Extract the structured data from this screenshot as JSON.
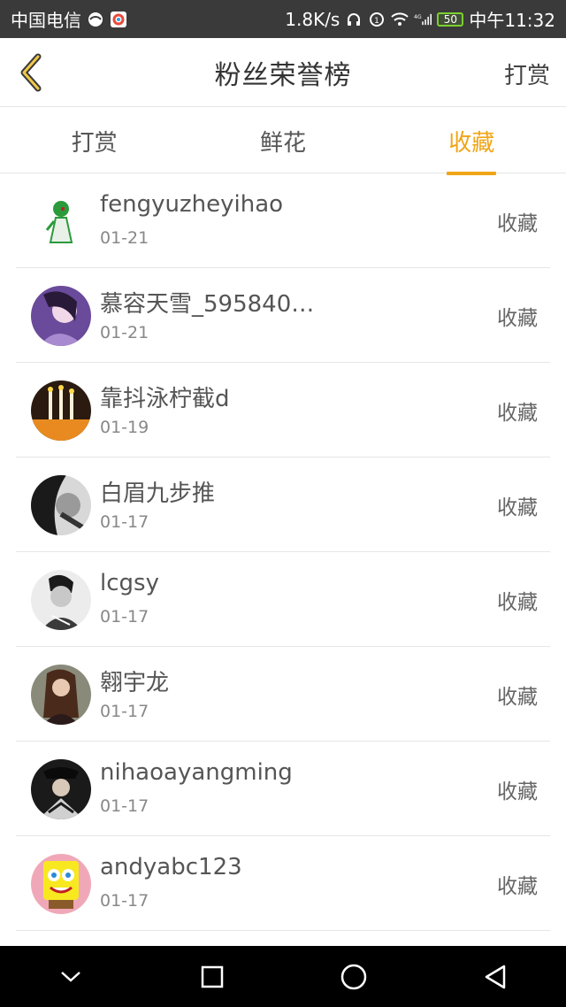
{
  "status_bar": {
    "carrier": "中国电信",
    "speed": "1.8K/s",
    "network": "4G",
    "battery": "50",
    "time": "中午11:32"
  },
  "header": {
    "title": "粉丝荣誉榜",
    "right_label": "打赏"
  },
  "tabs": [
    {
      "label": "打赏",
      "active": false
    },
    {
      "label": "鲜花",
      "active": false
    },
    {
      "label": "收藏",
      "active": true
    }
  ],
  "list": [
    {
      "name": "fengyuzheyihao",
      "date": "01-21",
      "action": "收藏"
    },
    {
      "name": "慕容天雪_595840…",
      "date": "01-21",
      "action": "收藏"
    },
    {
      "name": "靠抖泳柠截d",
      "date": "01-19",
      "action": "收藏"
    },
    {
      "name": "白眉九步推",
      "date": "01-17",
      "action": "收藏"
    },
    {
      "name": "lcgsy",
      "date": "01-17",
      "action": "收藏"
    },
    {
      "name": "翱宇龙",
      "date": "01-17",
      "action": "收藏"
    },
    {
      "name": "nihaoayangming",
      "date": "01-17",
      "action": "收藏"
    },
    {
      "name": "andyabc123",
      "date": "01-17",
      "action": "收藏"
    }
  ],
  "colors": {
    "accent": "#f0a516",
    "status_bar": "#3a3a3a",
    "nav_bar": "#000000",
    "divider": "#e6e6e6"
  }
}
